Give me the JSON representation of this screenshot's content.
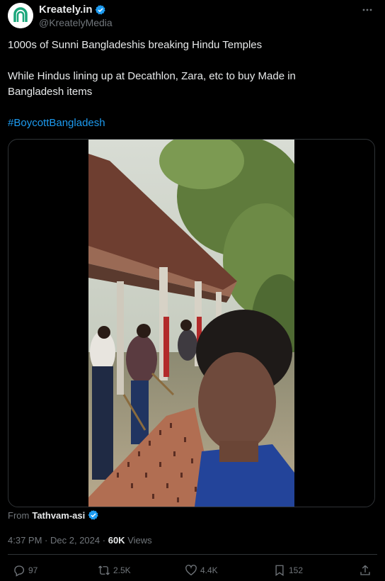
{
  "author": {
    "display_name": "Kreately.in",
    "handle": "@KreatelyMedia"
  },
  "post": {
    "line1": "1000s of Sunni Bangladeshis breaking Hindu Temples",
    "line2": "While Hindus lining up at Decathlon, Zara, etc to buy Made in",
    "line3": "Bangladesh items",
    "hashtag": "#BoycottBangladesh"
  },
  "source": {
    "prefix": "From",
    "name": "Tathvam-asi"
  },
  "meta": {
    "time": "4:37 PM",
    "separator": "·",
    "date": "Dec 2, 2024",
    "views_count": "60K",
    "views_label": "Views"
  },
  "actions": {
    "replies": "97",
    "reposts": "2.5K",
    "likes": "4.4K",
    "bookmarks": "152"
  },
  "colors": {
    "background": "#000000",
    "text": "#e7e9ea",
    "secondary": "#71767b",
    "accent": "#1d9bf0",
    "border": "#2f3336"
  },
  "icons": {
    "more": "more-icon",
    "verified": "verified-icon",
    "reply": "reply-icon",
    "repost": "repost-icon",
    "like": "heart-icon",
    "bookmark": "bookmark-icon",
    "share": "share-icon"
  }
}
